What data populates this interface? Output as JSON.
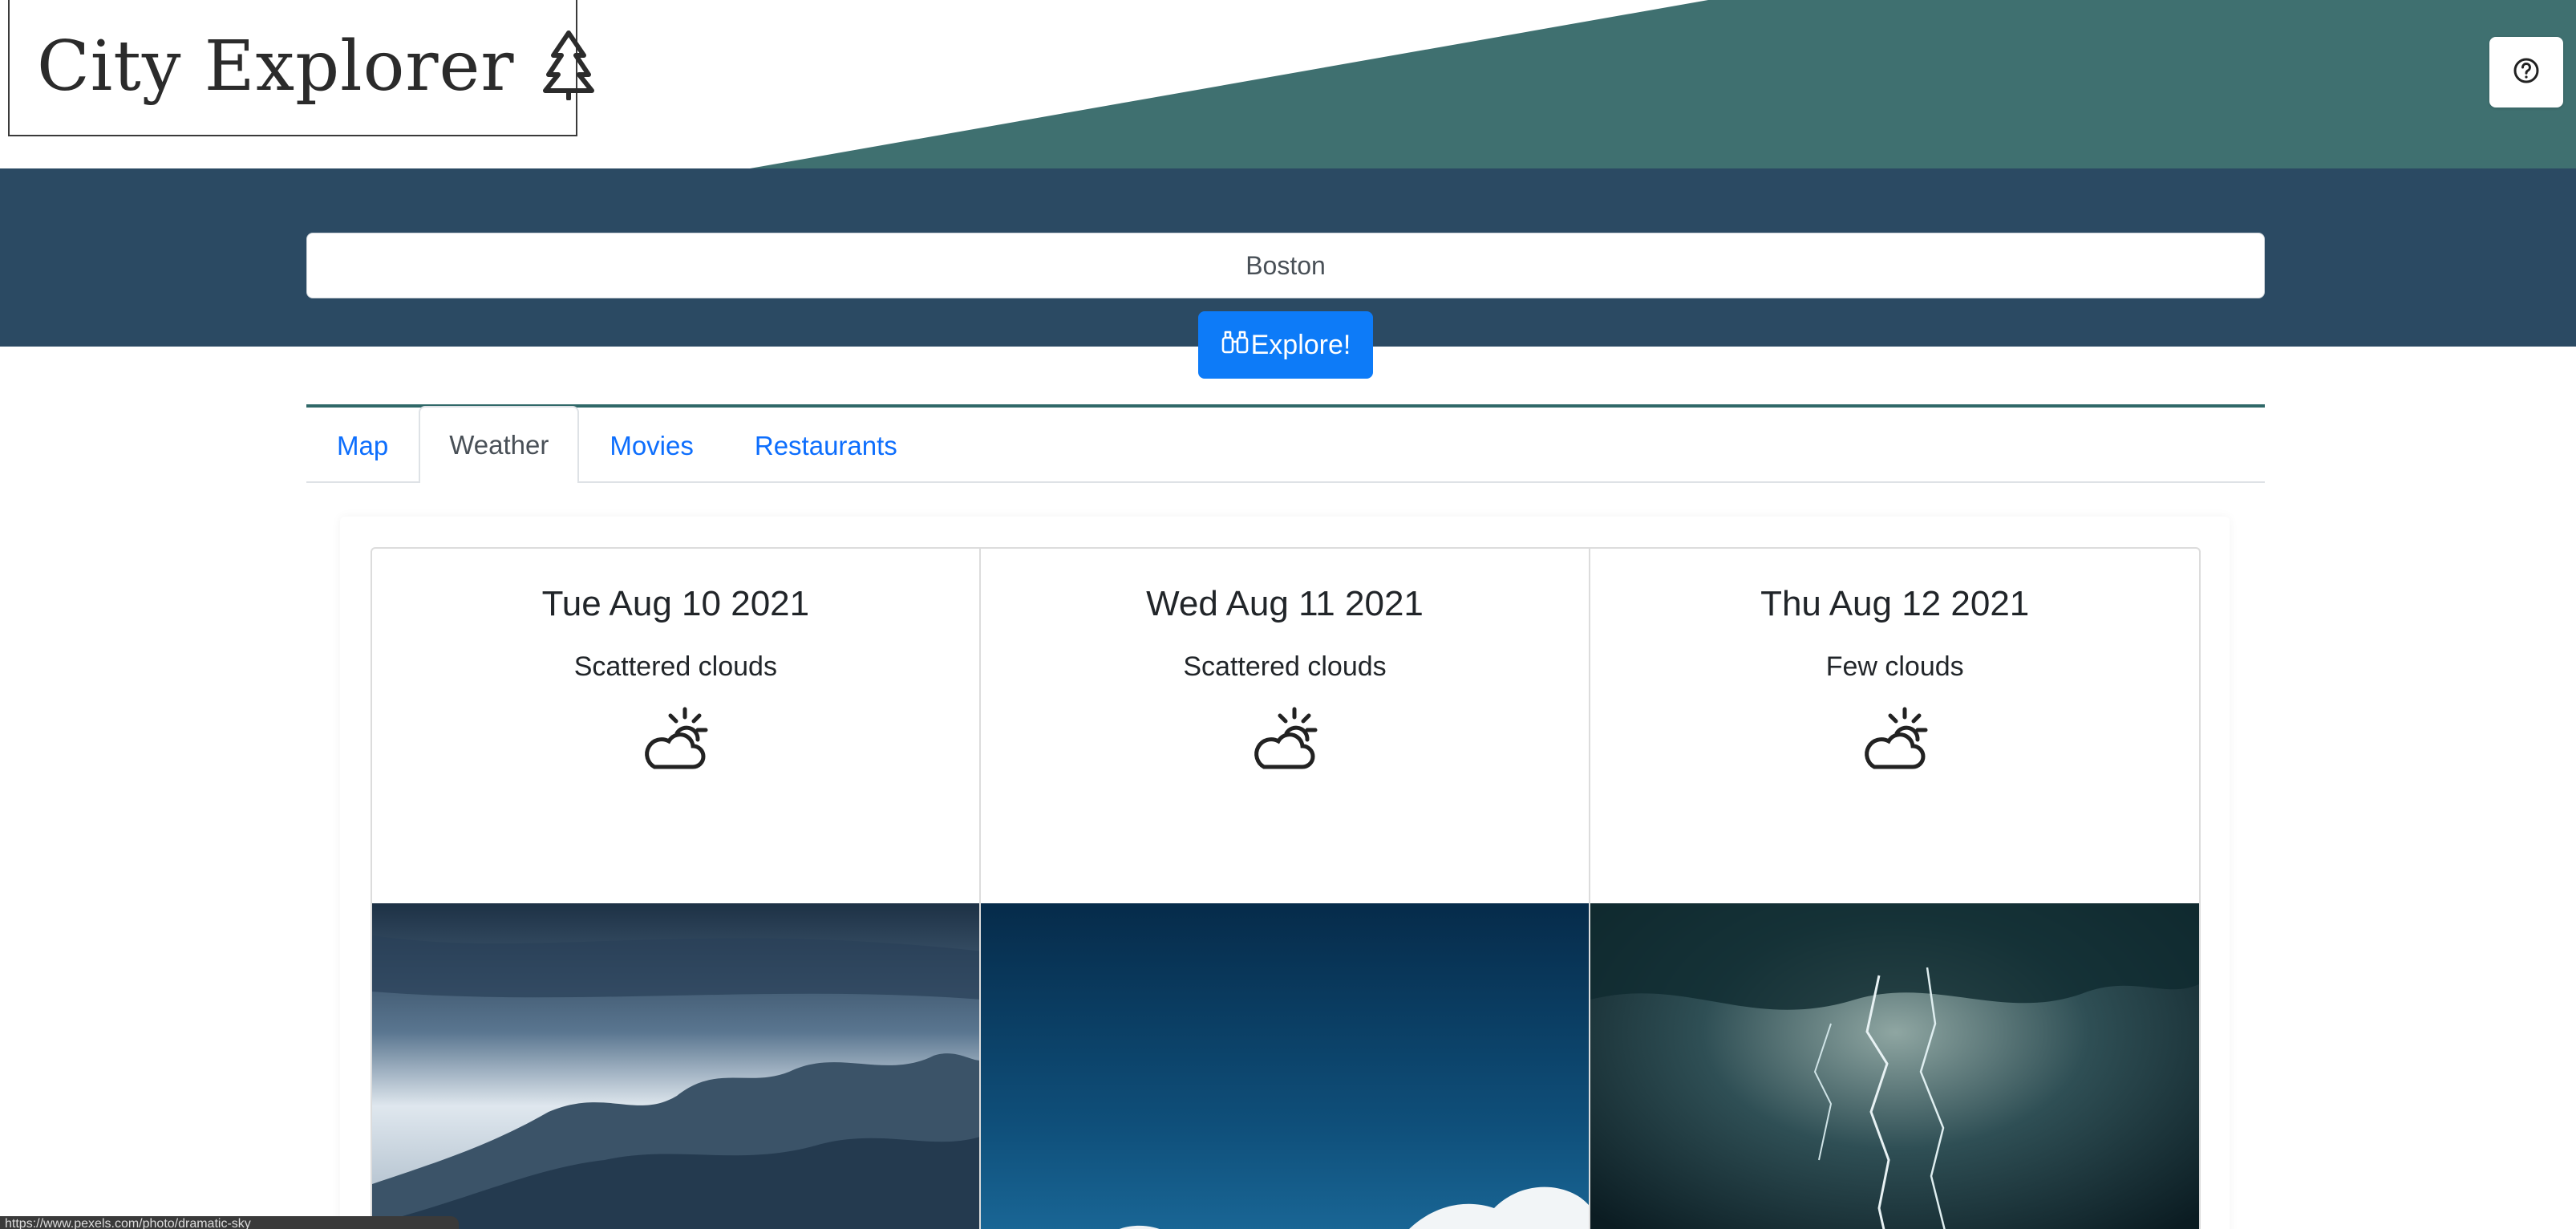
{
  "header": {
    "title": "City Explorer",
    "logo_icon": "pine-tree-icon",
    "help_icon": "question-circle-icon",
    "banner_color": "#3f7070"
  },
  "search": {
    "value": "Boston",
    "button_icon": "binoculars-icon",
    "button_label": "Explore!"
  },
  "tabs": [
    {
      "label": "Map",
      "active": false
    },
    {
      "label": "Weather",
      "active": true
    },
    {
      "label": "Movies",
      "active": false
    },
    {
      "label": "Restaurants",
      "active": false
    }
  ],
  "weather": {
    "days": [
      {
        "date": "Tue Aug 10 2021",
        "description": "Scattered clouds",
        "icon": "partly-cloudy-icon",
        "photo": "dramatic-storm-clouds"
      },
      {
        "date": "Wed Aug 11 2021",
        "description": "Scattered clouds",
        "icon": "partly-cloudy-icon",
        "photo": "blue-sky-clouds"
      },
      {
        "date": "Thu Aug 12 2021",
        "description": "Few clouds",
        "icon": "partly-cloudy-icon",
        "photo": "lightning-storm"
      }
    ]
  },
  "status_bar": {
    "text": "https://www.pexels.com/photo/dramatic-sky"
  },
  "colors": {
    "search_band": "#2b4a63",
    "accent_teal": "#3f7070",
    "button_blue": "#0d7bf8",
    "link_blue": "#0d6efd"
  }
}
